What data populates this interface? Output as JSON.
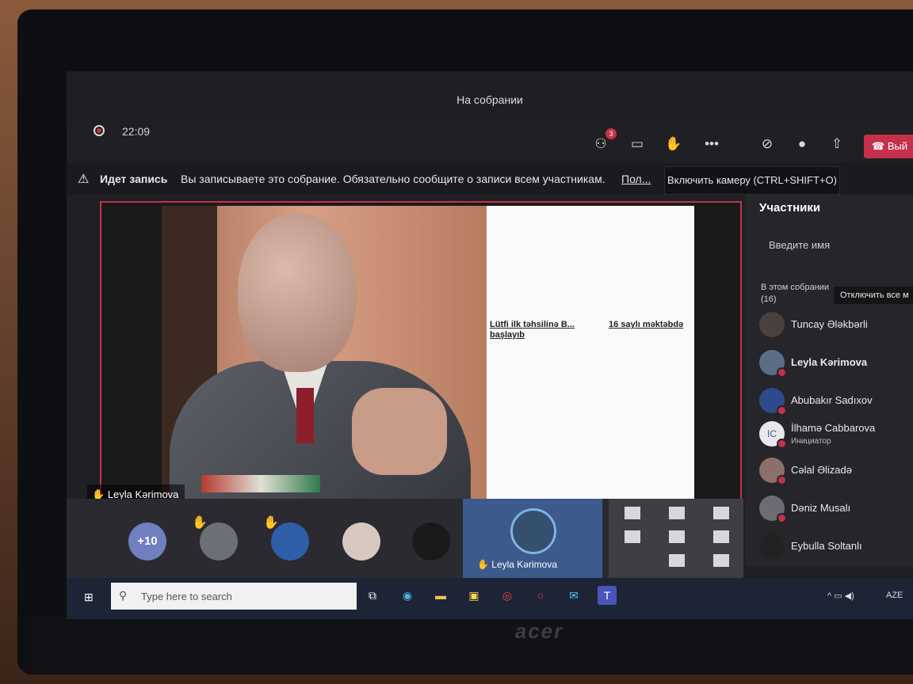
{
  "window": {
    "title": "На собрании"
  },
  "meeting": {
    "timer": "22:09"
  },
  "toolbar": {
    "participants_badge": "3",
    "leave_label": "Вый"
  },
  "banner": {
    "title": "Идет запись",
    "text": "Вы записываете это собрание. Обязательно сообщите о записи всем участникам.",
    "link": "Пол..."
  },
  "tooltip": {
    "camera": "Включить камеру (CTRL+SHIFT+O)"
  },
  "stage": {
    "doc_text_1": "Lütfi ilk təhsilinə B... başlayıb",
    "doc_text_2": "16 saylı məktəbdə",
    "presenter_name": "Leyla Kərimova"
  },
  "gallery": {
    "more_count": "+10",
    "active_speaker": "Leyla Kərimova"
  },
  "participants_panel": {
    "title": "Участники",
    "search_placeholder": "Введите имя",
    "section_label": "В этом собрании (16)",
    "mute_all_label": "Отключить все м",
    "people": [
      {
        "name": "Tuncay Ələkbərli",
        "initials": "",
        "role": ""
      },
      {
        "name": "Leyla Kərimova",
        "initials": "",
        "role": ""
      },
      {
        "name": "Abubakır Sadıxov",
        "initials": "",
        "role": ""
      },
      {
        "name": "İlhamə Cabbarova",
        "initials": "IC",
        "role": "Инициатор"
      },
      {
        "name": "Cəlal Əlizadə",
        "initials": "",
        "role": ""
      },
      {
        "name": "Dəniz Musalı",
        "initials": "",
        "role": ""
      },
      {
        "name": "Eybulla Soltanlı",
        "initials": "",
        "role": ""
      }
    ]
  },
  "taskbar": {
    "search_placeholder": "Type here to search",
    "language": "AZE"
  },
  "device": {
    "brand": "acer"
  },
  "icons": [
    "record-icon",
    "participants-icon",
    "chat-icon",
    "raise-hand-icon",
    "more-icon",
    "camera-off-icon",
    "mic-icon",
    "share-icon",
    "phone-icon",
    "warning-icon",
    "windows-start-icon",
    "search-icon",
    "task-view-icon",
    "edge-icon",
    "explorer-icon",
    "store-icon",
    "chrome-icon",
    "opera-icon",
    "mail-icon",
    "teams-icon"
  ]
}
